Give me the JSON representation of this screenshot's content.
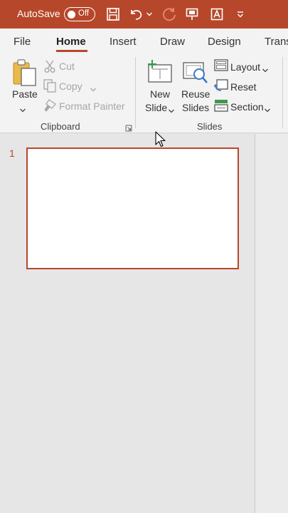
{
  "titlebar": {
    "autosave_label": "AutoSave",
    "autosave_state": "Off"
  },
  "tabs": [
    {
      "label": "File"
    },
    {
      "label": "Home"
    },
    {
      "label": "Insert"
    },
    {
      "label": "Draw"
    },
    {
      "label": "Design"
    },
    {
      "label": "Trans"
    }
  ],
  "ribbon": {
    "clipboard": {
      "group_label": "Clipboard",
      "paste_label": "Paste",
      "cut_label": "Cut",
      "copy_label": "Copy",
      "format_painter_label": "Format Painter"
    },
    "slides": {
      "group_label": "Slides",
      "new_slide_line1": "New",
      "new_slide_line2": "Slide",
      "reuse_slides_line1": "Reuse",
      "reuse_slides_line2": "Slides",
      "layout_label": "Layout",
      "reset_label": "Reset",
      "section_label": "Section"
    }
  },
  "thumbnails": [
    {
      "number": "1"
    }
  ],
  "colors": {
    "accent": "#b7472a",
    "ribbon_bg": "#f3f3f3",
    "workspace_bg": "#e6e6e6"
  }
}
